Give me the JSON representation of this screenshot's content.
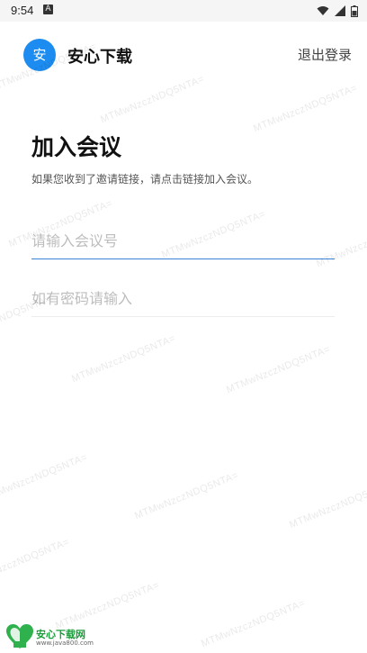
{
  "status_bar": {
    "time": "9:54",
    "notification_glyph": "A"
  },
  "header": {
    "avatar_text": "安",
    "app_name": "安心下载",
    "logout_label": "退出登录"
  },
  "main": {
    "title": "加入会议",
    "description": "如果您收到了邀请链接，请点击链接加入会议。",
    "meeting_id_input": {
      "placeholder": "请输入会议号",
      "value": ""
    },
    "password_input": {
      "placeholder": "如有密码请输入",
      "value": ""
    }
  },
  "watermark": {
    "text": "MTMwNzczNDQ5NTA="
  },
  "footer_logo": {
    "title": "安心下载网",
    "url": "www.java800.com"
  },
  "colors": {
    "accent": "#1d8cf0",
    "input_focus_line": "#3b83d6",
    "logo_green": "#1b9c3b"
  }
}
